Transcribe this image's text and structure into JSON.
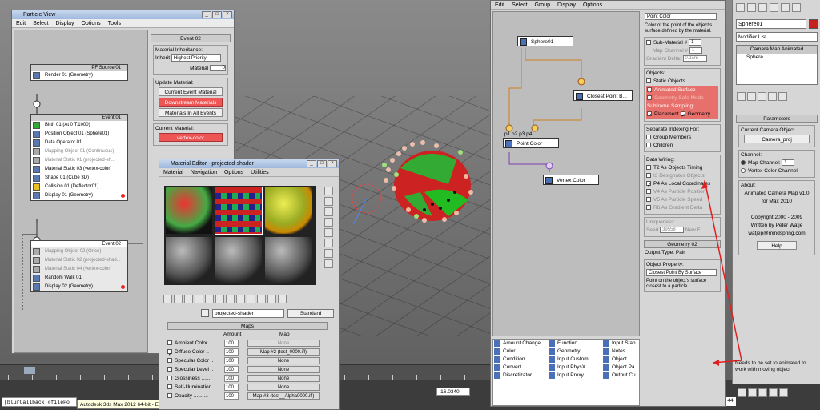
{
  "particle_view": {
    "title": "Particle View",
    "menu": [
      "Edit",
      "Select",
      "Display",
      "Options",
      "Tools"
    ],
    "pf_source": {
      "head": "PF Source 01",
      "rows": [
        "Render 01 (Geometry)"
      ]
    },
    "event01": {
      "head": "Event 01",
      "rows": [
        "Birth 01 (At 0 T:1000)",
        "Position Object 01 (Sphere01)",
        "Data Operator 01",
        "Mapping Object 01 (Continuous)",
        "Material Static 01 (projected-sh...",
        "Material Static 03 (vertex-color)",
        "Shape 01 (Cube 3D)",
        "Collision 01 (Deflector01)",
        "Display 01 (Geometry)"
      ]
    },
    "event02": {
      "head": "Event 02",
      "rows": [
        "Mapping Object 02 (Once)",
        "Material Static 02 (projected-shad...",
        "Material Static 04 (vertex-color)",
        "Random Walk 01",
        "Display 02 (Geometry)"
      ]
    },
    "props": {
      "rollout": "Event 02",
      "mi_title": "Material Inheritance:",
      "inherit_label": "Inherit",
      "inherit_value": "Highest Priority",
      "material_label": "Material",
      "material_value": "0",
      "um_title": "Update Material:",
      "btn1": "Current Event Material",
      "btn2": "Downstream Materials",
      "btn3": "Materials In All Events",
      "cm_title": "Current Material:",
      "cm_value": "vertex-color"
    }
  },
  "material_editor": {
    "title": "Material Editor - projected-shader",
    "menu": [
      "Material",
      "Navigation",
      "Options",
      "Utilities"
    ],
    "name": "projected-shader",
    "type": "Standard",
    "maps_title": "Maps",
    "col_amount": "Amount",
    "col_map": "Map",
    "rows": [
      {
        "label": "Ambient Color ..",
        "amount": "100",
        "map": "None"
      },
      {
        "label": "Diffuse Color ..",
        "amount": "100",
        "map": "Map #2 (test_0000.ifl)"
      },
      {
        "label": "Specular Color ..",
        "amount": "100",
        "map": "None"
      },
      {
        "label": "Specular Level ..",
        "amount": "100",
        "map": "None"
      },
      {
        "label": "Glossiness ......",
        "amount": "100",
        "map": "None"
      },
      {
        "label": "Self-Illumination ..",
        "amount": "100",
        "map": "None"
      },
      {
        "label": "Opacity ..........",
        "amount": "100",
        "map": "Map #3 (test__Alpha0000.ifl)"
      }
    ]
  },
  "data_view": {
    "menu": [
      "Edit",
      "Select",
      "Group",
      "Display",
      "Options"
    ],
    "nodes": {
      "sphere": "Sphere01",
      "closest": "Closest Point B...",
      "point_color": "Point Color",
      "vertex_color": "Vertex Color",
      "ports": "p1 p2 p3 p4"
    },
    "palette": {
      "col1": [
        "Amount Change",
        "Color",
        "Condition",
        "Convert",
        "Discretizator"
      ],
      "col2": [
        "Function",
        "Geometry",
        "Input Custom",
        "Input PhysX",
        "Input Proxy"
      ],
      "col3": [
        "Input Stan",
        "Notes",
        "Object",
        "Object Pa",
        "Output Cu"
      ]
    },
    "props": {
      "point_color_value": "Point Color",
      "desc1": "Color of the point of the object's surface defined by the material.",
      "sub_material": "Sub-Material #",
      "map_channel": "Map Channel #",
      "gradient_delta": "Gradient Delta:",
      "gd_value": "0.1cm",
      "one": "1",
      "objects_title": "Objects:",
      "static_objects": "Static Objects",
      "animated_surface": "Animated Surface",
      "geometry_safe": "Geometry Safe Mode",
      "subframe": "Subframe Sampling:",
      "placement": "Placement",
      "geometry": "Geometry",
      "sep_title": "Separate Indexing For:",
      "group_members": "Group Members",
      "children": "Children",
      "wiring_title": "Data Wiring:",
      "wiring": [
        "T2 As Objects Timing",
        "I3 Designates Objects",
        "P4 As Local Coordinates",
        "V4 As Particle Position",
        "V5 As Particle Speed",
        "R6 As Gradient Delta"
      ],
      "unique_title": "Uniqueness:",
      "seed_label": "Seed",
      "seed_value": "39558",
      "new": "New",
      "f": "F",
      "geo_rollout": "Geometry 02",
      "output_type": "Output Type: Pair",
      "obj_prop": "Object Property:",
      "closest_value": "Closest Point By Surface",
      "desc2": "Point on the object's surface closest to a particle."
    }
  },
  "command_panel": {
    "name": "Sphere01",
    "modifier_list": "Modifier List",
    "stack": [
      "Camera Map Animated",
      "Sphere"
    ],
    "params": "Parameters",
    "cco": "Current Camera Object",
    "camera": "Camera_proj",
    "channel": "Channel:",
    "map_channel": "Map Channel:",
    "mc_value": "1",
    "vcc": "Vertex Color Channel",
    "about": "About:",
    "about_lines": [
      "Animated Camera Map v1.0",
      "for Max 2010",
      "",
      "Copyright 2000 - 2009",
      "Written by Peter Watje",
      "watjep@mindspring.com"
    ],
    "help": "Help"
  },
  "annotation": {
    "text": "Needs to be set to animated to work with moving object",
    "color": "#e02020"
  },
  "status": {
    "script": "[blurCallback #filePo",
    "tooltip": "Autodesk 3ds Max 2012 64-bit - English",
    "coord": "-16.0340",
    "frame": "44"
  }
}
